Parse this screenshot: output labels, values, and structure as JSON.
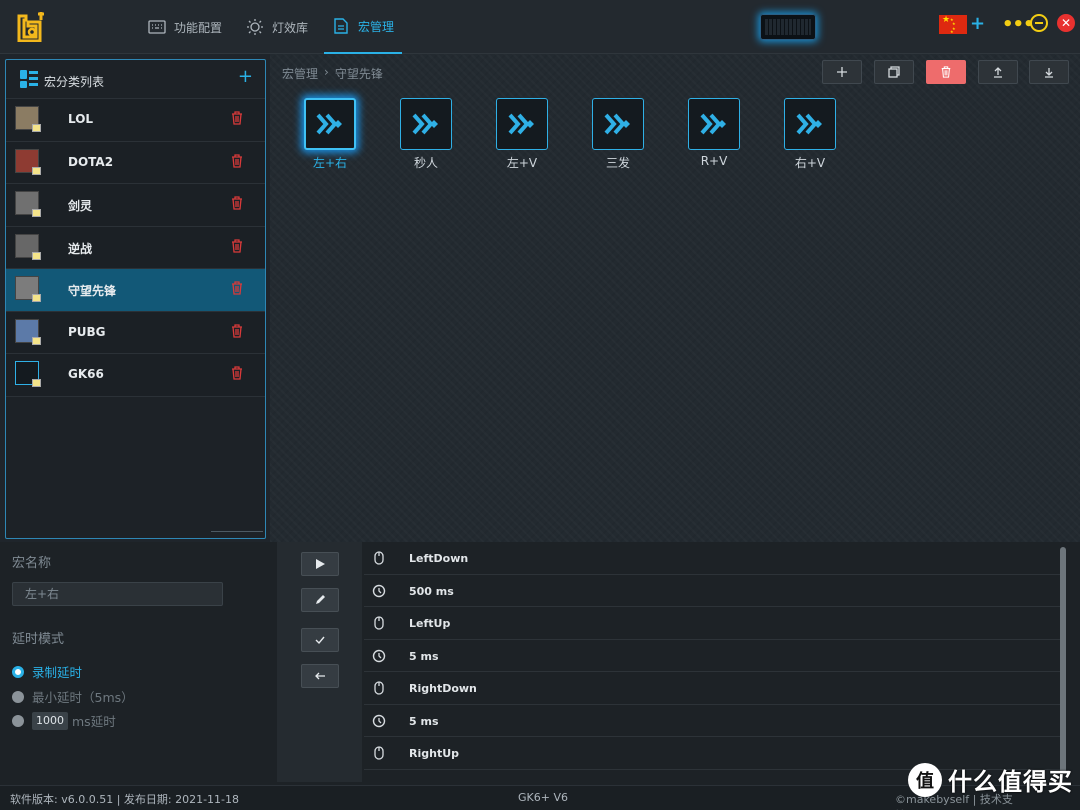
{
  "nav": {
    "items": [
      {
        "label": "功能配置",
        "icon": "keyboard-icon",
        "active": false
      },
      {
        "label": "灯效库",
        "icon": "light-icon",
        "active": false
      },
      {
        "label": "宏管理",
        "icon": "document-icon",
        "active": true
      }
    ]
  },
  "sidebar": {
    "title": "宏分类列表",
    "add_label": "+",
    "items": [
      {
        "label": "LOL",
        "selected": false
      },
      {
        "label": "DOTA2",
        "selected": false
      },
      {
        "label": "剑灵",
        "selected": false
      },
      {
        "label": "逆战",
        "selected": false
      },
      {
        "label": "守望先锋",
        "selected": true
      },
      {
        "label": "PUBG",
        "selected": false
      },
      {
        "label": "GK66",
        "selected": false
      }
    ]
  },
  "breadcrumb": {
    "root": "宏管理",
    "sep": "›",
    "current": "守望先锋"
  },
  "macros": [
    {
      "label": "左+右",
      "selected": true
    },
    {
      "label": "秒人",
      "selected": false
    },
    {
      "label": "左+V",
      "selected": false
    },
    {
      "label": "三发",
      "selected": false
    },
    {
      "label": "R+V",
      "selected": false
    },
    {
      "label": "右+V",
      "selected": false
    }
  ],
  "editor": {
    "name_title": "宏名称",
    "name_placeholder": "左+右",
    "delay_title": "延时模式",
    "delay_options": {
      "record": "录制延时",
      "minimum": "最小延时（5ms）",
      "custom_value": "1000",
      "custom_suffix": "ms延时"
    },
    "steps": [
      {
        "icon": "mouse-icon",
        "text": "LeftDown"
      },
      {
        "icon": "clock-icon",
        "text": "500 ms"
      },
      {
        "icon": "mouse-icon",
        "text": "LeftUp"
      },
      {
        "icon": "clock-icon",
        "text": "5 ms"
      },
      {
        "icon": "mouse-icon",
        "text": "RightDown"
      },
      {
        "icon": "clock-icon",
        "text": "5 ms"
      },
      {
        "icon": "mouse-icon",
        "text": "RightUp"
      }
    ]
  },
  "status": {
    "left": "软件版本: v6.0.0.51 | 发布日期: 2021-11-18",
    "center": "GK6+ V6",
    "right": "©makebyself | 技术支持:makebyself"
  },
  "watermark": {
    "badge": "值",
    "text": "什么值得买"
  },
  "colors": {
    "accent": "#2ab1e6",
    "danger": "#e8312f",
    "delete_icon": "#d93a3a",
    "selected_row": "#125877"
  }
}
